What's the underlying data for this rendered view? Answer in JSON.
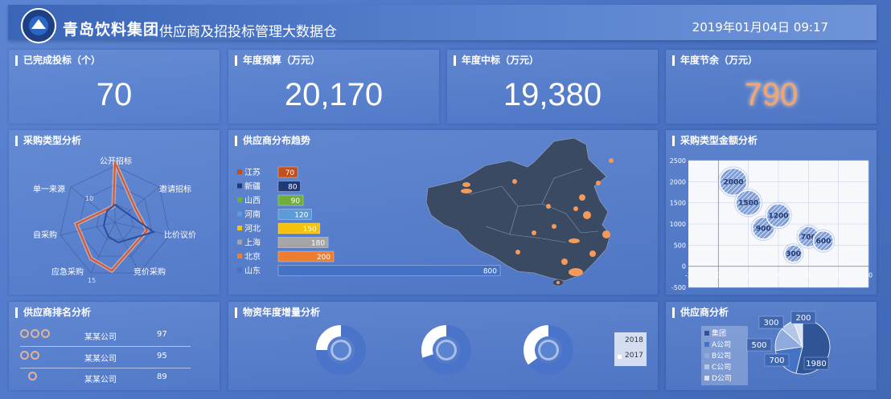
{
  "header": {
    "company": "青岛饮料集团",
    "subtitle": "供应商及招投标管理大数据仓",
    "datetime": "2019年01月04日   09:17"
  },
  "kpis": [
    {
      "title": "已完成投标（个）",
      "value": "70"
    },
    {
      "title": "年度预算（万元）",
      "value": "20,170"
    },
    {
      "title": "年度中标（万元）",
      "value": "19,380"
    },
    {
      "title": "年度节余（万元）",
      "value": "790"
    }
  ],
  "radar": {
    "title": "采购类型分析",
    "axes": [
      "公开招标",
      "邀请招标",
      "比价议价",
      "竞价采购",
      "应急采购",
      "自采购",
      "单一来源"
    ],
    "tick_labels": [
      "10",
      "15"
    ]
  },
  "map_panel": {
    "title": "供应商分布趋势"
  },
  "bubble_panel": {
    "title": "采购类型金额分析"
  },
  "rank_panel": {
    "title": "供应商排名分析",
    "rows": [
      {
        "name": "某某公司",
        "value": "97",
        "medals": 3
      },
      {
        "name": "某某公司",
        "value": "95",
        "medals": 2
      },
      {
        "name": "某某公司",
        "value": "89",
        "medals": 1
      }
    ]
  },
  "donut_panel": {
    "title": "物资年度增量分析",
    "legend": [
      "2018",
      "2017"
    ]
  },
  "pie_panel": {
    "title": "供应商分析"
  },
  "colors": {
    "accent_orange": "#f7a46b",
    "panel_blue": "#5b85d3"
  },
  "chart_data": [
    {
      "type": "bar",
      "categories": [
        "江苏",
        "新疆",
        "山西",
        "河南",
        "河北",
        "上海",
        "北京",
        "山东"
      ],
      "values": [
        70,
        80,
        90,
        120,
        150,
        180,
        200,
        800
      ],
      "colors": [
        "#c0501f",
        "#1f3a78",
        "#6fae3a",
        "#5c9ad8",
        "#f4c20d",
        "#a5a5a5",
        "#ed7d31",
        "#4472c4"
      ],
      "title": "供应商分布趋势"
    },
    {
      "type": "scatter",
      "title": "采购类型金额分析",
      "points": [
        {
          "x": 1,
          "y": 2000,
          "label": "2000"
        },
        {
          "x": 2,
          "y": 1500,
          "label": "1500"
        },
        {
          "x": 3,
          "y": 900,
          "label": "900"
        },
        {
          "x": 4,
          "y": 1200,
          "label": "1200"
        },
        {
          "x": 5,
          "y": 300,
          "label": "300"
        },
        {
          "x": 6,
          "y": 700,
          "label": "700"
        },
        {
          "x": 7,
          "y": 600,
          "label": "600"
        }
      ],
      "xlim": [
        -2,
        10
      ],
      "ylim": [
        -500,
        2500
      ],
      "xticks": [
        "-2",
        "0",
        "2",
        "4",
        "6",
        "8",
        "10"
      ],
      "yticks": [
        "2500",
        "2000",
        "1500",
        "1000",
        "500",
        "0",
        "-500"
      ]
    },
    {
      "type": "pie",
      "title": "供应商分析",
      "categories": [
        "集团",
        "A公司",
        "B公司",
        "C公司",
        "D公司"
      ],
      "values": [
        1980,
        700,
        500,
        300,
        200
      ],
      "colors": [
        "#2f5597",
        "#4472c4",
        "#8faadc",
        "#b4c7e7",
        "#dae3f3"
      ]
    },
    {
      "type": "area",
      "title": "物资年度增量分析",
      "series": [
        {
          "name": "2018",
          "values": [
            75,
            70,
            65
          ]
        },
        {
          "name": "2017",
          "values": [
            25,
            30,
            35
          ]
        }
      ]
    }
  ]
}
